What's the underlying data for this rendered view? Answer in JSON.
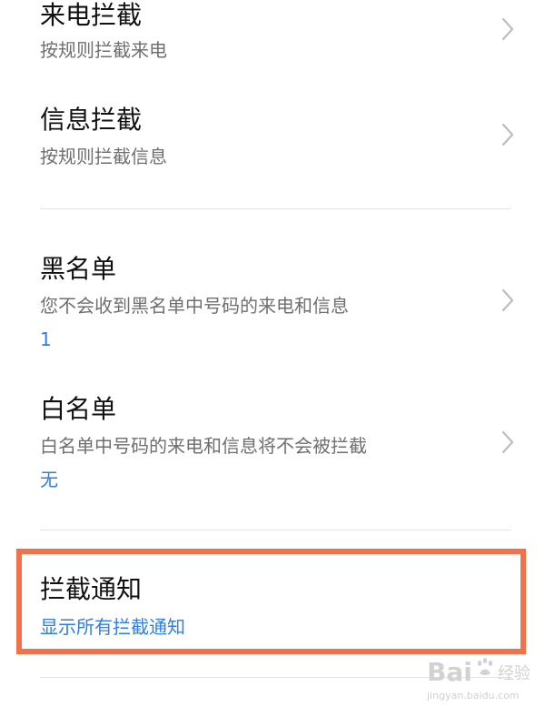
{
  "settings": {
    "items": [
      {
        "title": "来电拦截",
        "subtitle": "按规则拦截来电",
        "chevron_icon": "chevron-right-icon"
      },
      {
        "title": "信息拦截",
        "subtitle": "按规则拦截信息",
        "chevron_icon": "chevron-right-icon"
      },
      {
        "title": "黑名单",
        "subtitle": "您不会收到黑名单中号码的来电和信息",
        "value": "1",
        "chevron_icon": "chevron-right-icon"
      },
      {
        "title": "白名单",
        "subtitle": "白名单中号码的来电和信息将不会被拦截",
        "value": "无",
        "chevron_icon": "chevron-right-icon"
      },
      {
        "title": "拦截通知",
        "subtitle": "显示所有拦截通知"
      }
    ]
  },
  "watermark": {
    "brand": "Bai",
    "label": "经验",
    "url": "jingyan.baidu.com"
  },
  "colors": {
    "background": "#ffffff",
    "title": "#111111",
    "subtitle": "#6f6f6f",
    "accent": "#2f7fe0",
    "divider": "#e4e4e4",
    "highlight": "#f2714a",
    "chevron": "#bdbdbd"
  }
}
